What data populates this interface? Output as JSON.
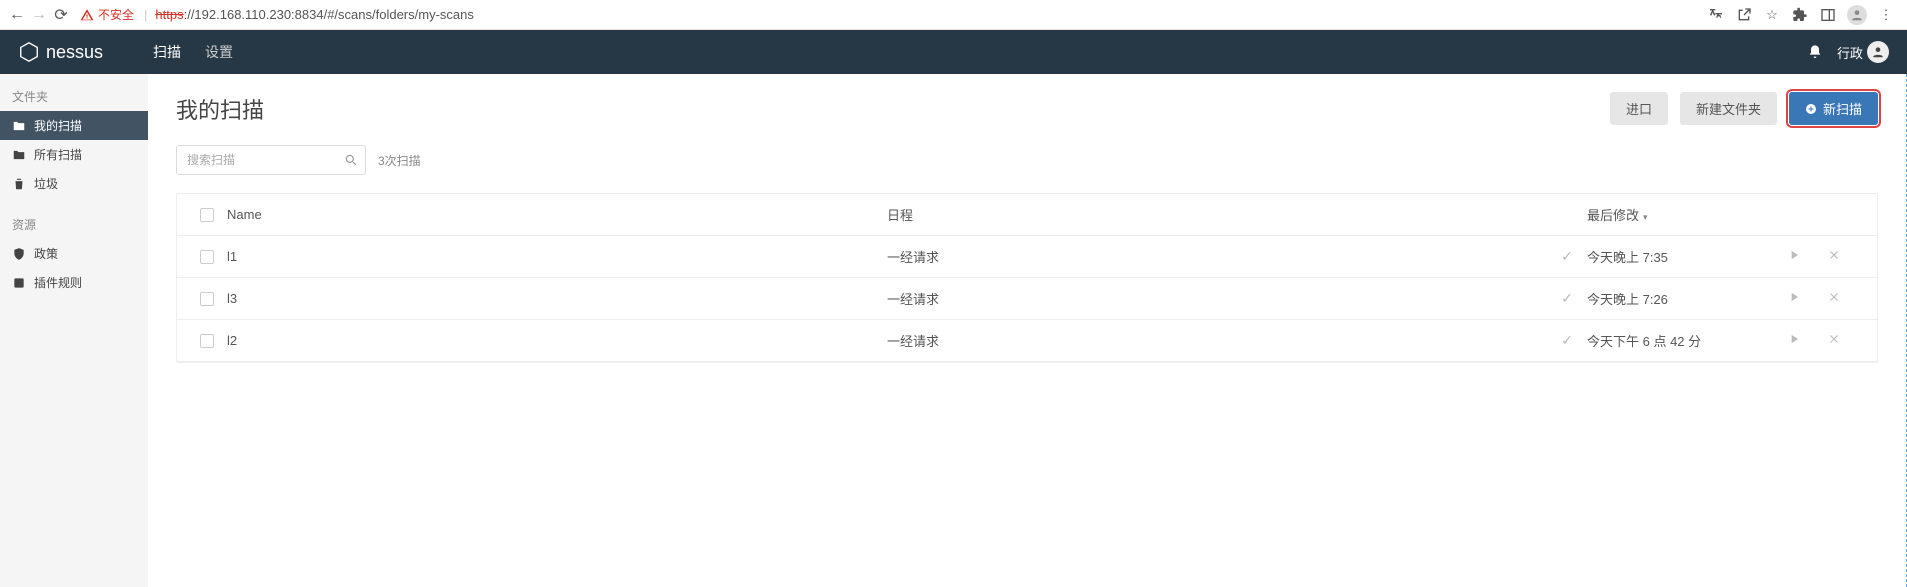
{
  "browser": {
    "security_label": "不安全",
    "url_protocol": "https",
    "url_rest": "://192.168.110.230:8834/#/scans/folders/my-scans"
  },
  "header": {
    "logo": "nessus",
    "nav": {
      "scan": "扫描",
      "settings": "设置"
    },
    "account_label": "行政"
  },
  "sidebar": {
    "section_folders": "文件夹",
    "my_scans": "我的扫描",
    "all_scans": "所有扫描",
    "trash": "垃圾",
    "section_resources": "资源",
    "policies": "政策",
    "plugin_rules": "插件规则"
  },
  "main": {
    "title": "我的扫描",
    "btn_import": "进口",
    "btn_new_folder": "新建文件夹",
    "btn_new_scan": "新扫描",
    "search_placeholder": "搜索扫描",
    "count_text": "3次扫描",
    "columns": {
      "name": "Name",
      "schedule": "日程",
      "last_modified": "最后修改"
    },
    "rows": [
      {
        "name": "l1",
        "schedule": "一经请求",
        "modified": "今天晚上 7:35"
      },
      {
        "name": "l3",
        "schedule": "一经请求",
        "modified": "今天晚上 7:26"
      },
      {
        "name": "l2",
        "schedule": "一经请求",
        "modified": "今天下午 6 点 42 分"
      }
    ]
  }
}
